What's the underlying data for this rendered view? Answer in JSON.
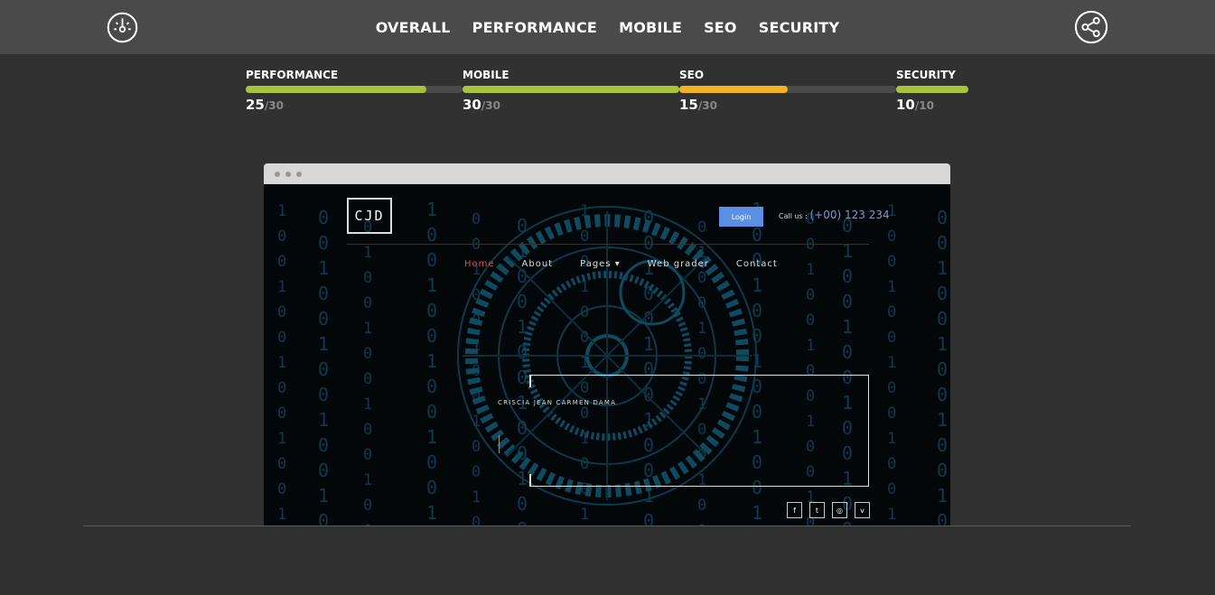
{
  "nav": {
    "items": [
      "OVERALL",
      "PERFORMANCE",
      "MOBILE",
      "SEO",
      "SECURITY"
    ]
  },
  "scores": [
    {
      "label": "PERFORMANCE",
      "value": "25",
      "max": "/30",
      "fraction": 0.8333,
      "color": "#a8c23a"
    },
    {
      "label": "MOBILE",
      "value": "30",
      "max": "/30",
      "fraction": 1.0,
      "color": "#a8c23a"
    },
    {
      "label": "SEO",
      "value": "15",
      "max": "/30",
      "fraction": 0.5,
      "color": "#f4b220"
    },
    {
      "label": "SECURITY",
      "value": "10",
      "max": "/10",
      "fraction": 1.0,
      "color": "#a8c23a"
    }
  ],
  "preview": {
    "logo_text": "CJD",
    "login_label": "Login",
    "callus_label": "Call us :",
    "phone": "(+00) 123 234",
    "site_nav": [
      {
        "label": "Home",
        "active": true
      },
      {
        "label": "About",
        "active": false
      },
      {
        "label": "Pages ▾",
        "active": false
      },
      {
        "label": "Web grader",
        "active": false
      },
      {
        "label": "Contact",
        "active": false
      }
    ],
    "hero_name": "CRISCIA JEAN CARMEN DAMA",
    "social_icons": [
      "facebook-icon",
      "twitter-icon",
      "dribbble-icon",
      "vimeo-icon"
    ],
    "social_glyphs": [
      "f",
      "t",
      "◎",
      "v"
    ]
  },
  "colors": {
    "topbar": "#4a4a4a",
    "background": "#313131",
    "good": "#a8c23a",
    "warn": "#f4b220",
    "accent_link": "#7c96d6",
    "active_nav": "#e14d43"
  }
}
